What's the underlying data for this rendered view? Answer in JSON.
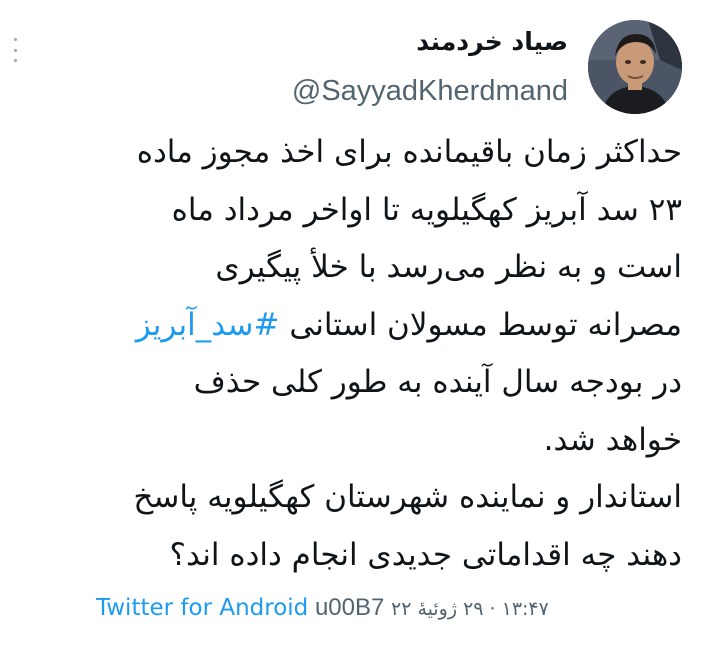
{
  "user": {
    "display_name": "صیاد خردمند",
    "handle": "@SayyadKherdmand",
    "avatar_icon": "profile-photo"
  },
  "more_icon": "vertical-ellipsis-icon",
  "tweet": {
    "lines": [
      "حداکثر زمان باقیمانده برای اخذ مجوز ماده",
      "۲۳ سد آبریز کهگیلویه تا اواخر مرداد ماه",
      "است و به نظر می‌رسد با خلأ پیگیری",
      "مصرانه  توسط مسولان استانی ",
      "در بودجه سال آینده به طور کلی حذف",
      "خواهد شد.",
      "استاندار و نماینده شهرستان کهگیلویه پاسخ",
      "دهند چه اقداماتی جدیدی انجام داده اند؟"
    ],
    "hashtag": "#سد_آبریز"
  },
  "meta": {
    "source": "Twitter for Android",
    "separator": "u00B7",
    "date": "۱۳:۴۷ · ۲۹ ژوئیهٔ ۲۲"
  },
  "colors": {
    "text": "#0f1419",
    "secondary": "#536471",
    "link": "#1d9bf0",
    "background": "#ffffff"
  }
}
